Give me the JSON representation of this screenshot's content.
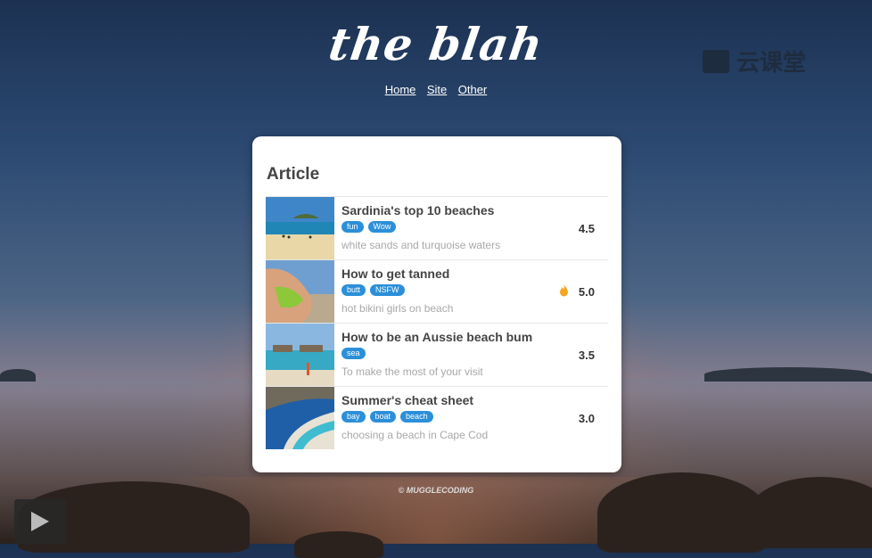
{
  "brand": {
    "logo": "the blah",
    "watermark": "云课堂"
  },
  "nav": [
    {
      "label": "Home"
    },
    {
      "label": "Site"
    },
    {
      "label": "Other"
    }
  ],
  "article": {
    "heading": "Article",
    "items": [
      {
        "title": "Sardinia's top 10 beaches",
        "tags": [
          "fun",
          "Wow"
        ],
        "description": "white sands and turquoise waters",
        "rating": "4.5",
        "hot": false
      },
      {
        "title": "How to get tanned",
        "tags": [
          "butt",
          "NSFW"
        ],
        "description": "hot bikini girls on beach",
        "rating": "5.0",
        "hot": true
      },
      {
        "title": "How to be an Aussie beach bum",
        "tags": [
          "sea"
        ],
        "description": "To make the most of your visit",
        "rating": "3.5",
        "hot": false
      },
      {
        "title": "Summer's cheat sheet",
        "tags": [
          "bay",
          "boat",
          "beach"
        ],
        "description": "choosing a beach in Cape Cod",
        "rating": "3.0",
        "hot": false
      }
    ]
  },
  "footer": "© MUGGLECODING",
  "icons": {
    "hot": "fire-icon",
    "player": "play-icon"
  },
  "colors": {
    "tag": "#2b8fd9",
    "fire": "#f5a623"
  }
}
